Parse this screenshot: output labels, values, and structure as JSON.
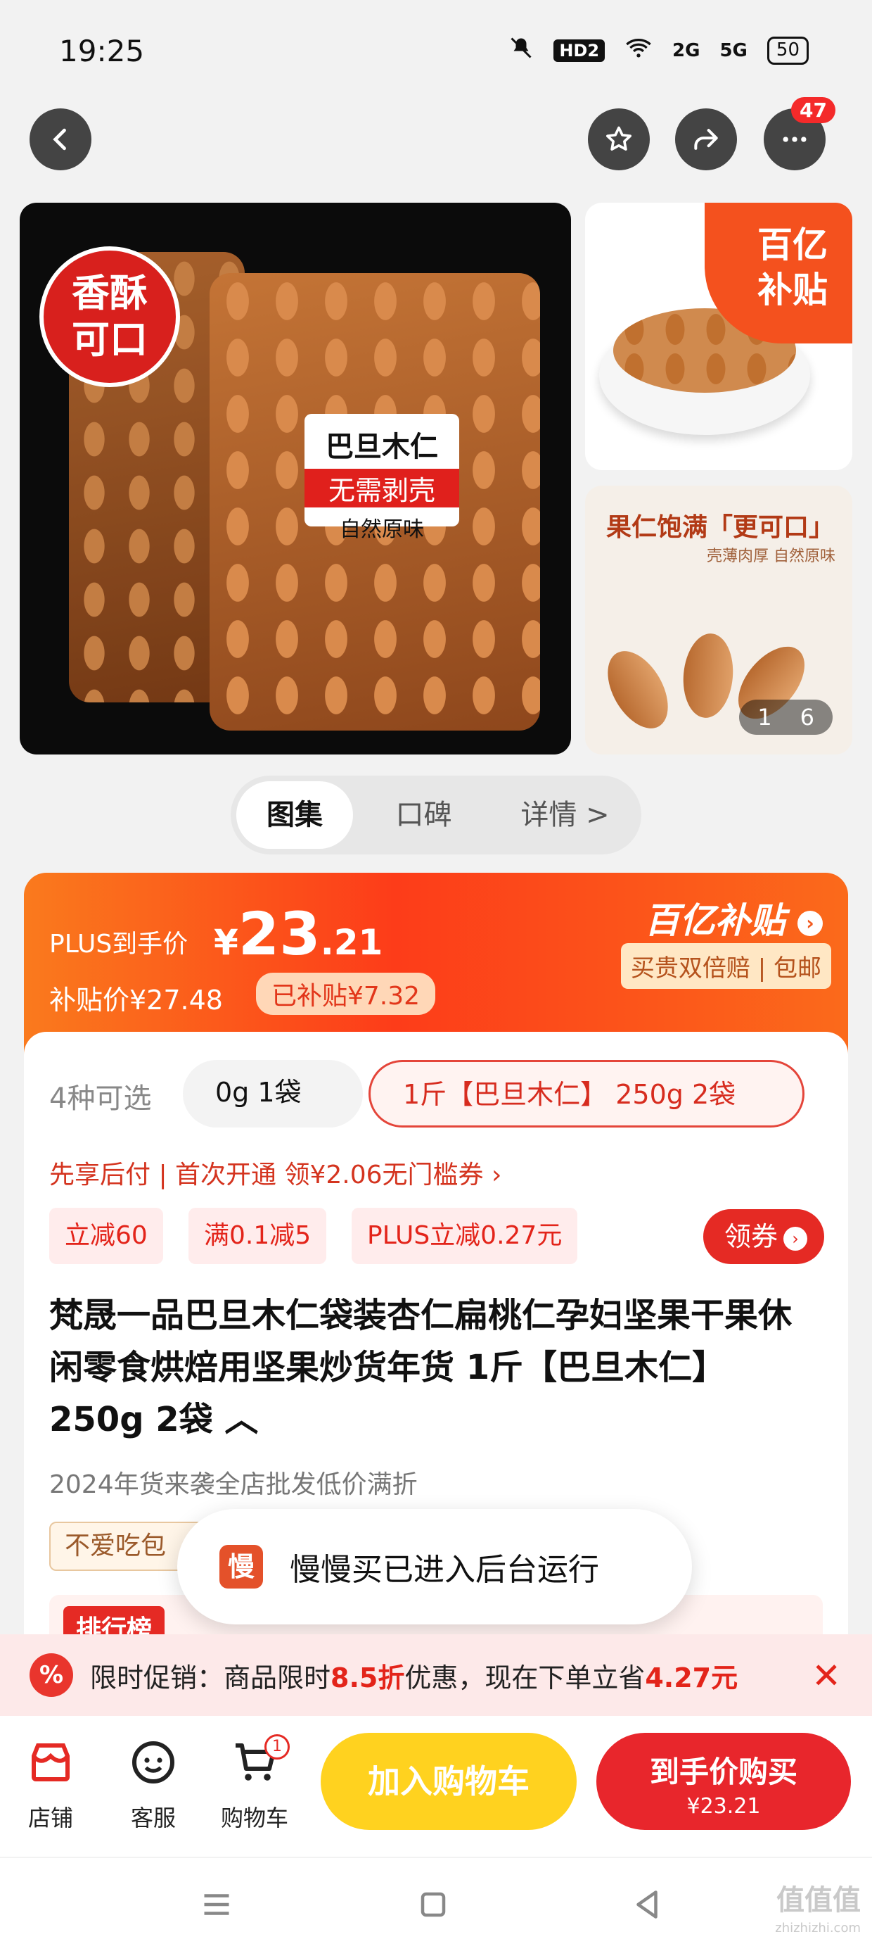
{
  "status": {
    "time": "19:25",
    "hd": "HD2",
    "sig1": "2G",
    "sig2": "5G",
    "battery": "50"
  },
  "nav": {
    "badge_count": "47"
  },
  "gallery": {
    "seal_text": "香酥可口",
    "bag_label": {
      "line1": "巴旦木仁",
      "line2": "无需剥壳",
      "line3": "自然原味"
    },
    "yi_tag": "百亿补贴",
    "side2_title": "果仁饱满「更可口」",
    "side2_sub": "壳薄肉厚 自然原味",
    "counter_left": "1",
    "counter_right": "6"
  },
  "tabs": [
    "图集",
    "口碑",
    "详情 >"
  ],
  "price": {
    "plus_label": "PLUS到手价",
    "currency": "¥",
    "int": "23",
    "dec": ".21",
    "subsidy_price": "补贴价¥27.48",
    "subsidized": "已补贴¥7.32",
    "logo": "百亿补贴",
    "guarantee": "买贵双倍赔 | 包邮"
  },
  "specs": {
    "count": "4种可选",
    "option1": "0g 1袋",
    "option2": "1斤【巴旦木仁】 250g 2袋"
  },
  "promo_line": "先享后付 | 首次开通 领¥2.06无门槛券 ›",
  "chips": [
    "立减60",
    "满0.1减5",
    "PLUS立减0.27元"
  ],
  "coupon_btn": "领券",
  "title": "梵晟一品巴旦木仁袋装杏仁扁桃仁孕妇坚果干果休闲零食烘焙用坚果炒货年货 1斤【巴旦木仁】 250g 2袋 ︿",
  "subtitle": "2024年货来袭全店批发低价满折",
  "tag_beige": "不爱吃包",
  "rank_label": "排行榜",
  "toast": {
    "app_glyph": "慢",
    "message": "慢慢买已进入后台运行"
  },
  "limit_promo": {
    "pct": "%",
    "prefix": "限时促销：商品限时",
    "discount": "8.5折",
    "middle": "优惠，现在下单立省",
    "save": "4.27元",
    "close": "✕"
  },
  "bottom": {
    "store": "店铺",
    "service": "客服",
    "cart": "购物车",
    "cart_count": "1",
    "add_cart": "加入购物车",
    "buy": "到手价购买",
    "buy_price": "¥23.21"
  },
  "watermark": {
    "main": "值值值",
    "sub": "zhizhizhi.com"
  }
}
